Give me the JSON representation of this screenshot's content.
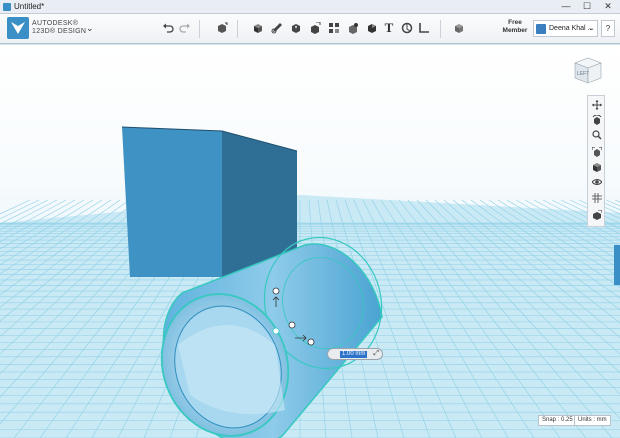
{
  "window": {
    "title": "Untitled*",
    "controls": [
      "—",
      "☐",
      "✕"
    ]
  },
  "app": {
    "brand_top": "AUTODESK®",
    "brand_bottom": "123D® DESIGN",
    "menu_chevron": "⌄"
  },
  "toolbar": {
    "buttons": [
      {
        "name": "undo-button",
        "icon": "undo-arrow-icon"
      },
      {
        "name": "redo-button",
        "icon": "redo-arrow-icon"
      },
      {
        "name": "transform-button",
        "icon": "transform-icon"
      },
      {
        "name": "primitives-button",
        "icon": "box-primitive-icon"
      },
      {
        "name": "sketch-button",
        "icon": "sketch-pencil-icon"
      },
      {
        "name": "construct-button",
        "icon": "construct-icon"
      },
      {
        "name": "modify-button",
        "icon": "modify-icon"
      },
      {
        "name": "pattern-button",
        "icon": "pattern-icon"
      },
      {
        "name": "group-button",
        "icon": "group-icon"
      },
      {
        "name": "combine-button",
        "icon": "combine-icon"
      },
      {
        "name": "text-button",
        "icon": "text-t-icon"
      },
      {
        "name": "snap-button",
        "icon": "snap-icon"
      },
      {
        "name": "measure-button",
        "icon": "ruler-icon"
      },
      {
        "name": "material-button",
        "icon": "material-cube-icon"
      }
    ],
    "text_glyph": "T",
    "member_label": "Free\nMember",
    "user_name": "Deena Khal ...",
    "user_chevron": "⌄",
    "help_label": "?"
  },
  "viewcube": {
    "label": "LEFT"
  },
  "nav_tools": [
    {
      "name": "pan-tool",
      "icon": "pan-arrows-icon"
    },
    {
      "name": "orbit-tool",
      "icon": "orbit-icon"
    },
    {
      "name": "zoom-tool",
      "icon": "zoom-magnifier-icon"
    },
    {
      "name": "fit-tool",
      "icon": "fit-view-icon"
    },
    {
      "name": "perspective-tool",
      "icon": "perspective-cube-icon"
    },
    {
      "name": "visibility-tool",
      "icon": "eye-icon"
    },
    {
      "name": "grid-tool",
      "icon": "grid-icon"
    },
    {
      "name": "materials-tool",
      "icon": "materials-icon"
    }
  ],
  "dimension_input": {
    "value": "1.00 mm",
    "tool_glyph": "⤢"
  },
  "status": {
    "snap": "Snap : 0.25",
    "units": "Units : mm"
  },
  "colors": {
    "accent": "#3b8fc7",
    "solid": "#3c8fbf",
    "selection": "#37c8c0",
    "grid": "#8fd0e6"
  }
}
